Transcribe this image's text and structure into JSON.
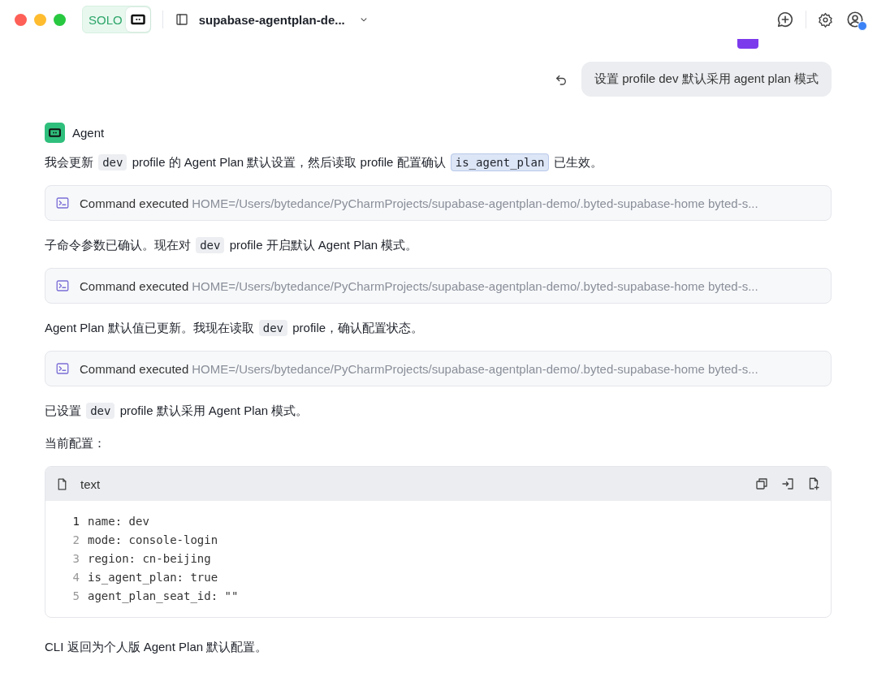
{
  "titlebar": {
    "mode_label": "SOLO",
    "mode_on": true,
    "project": "supabase-agentplan-de..."
  },
  "user_message": {
    "text": "设置 profile dev 默认采用 agent plan 模式"
  },
  "agent": {
    "name": "Agent"
  },
  "blocks": [
    {
      "kind": "para",
      "parts": [
        {
          "kind": "text",
          "text": "我会更新 "
        },
        {
          "kind": "code",
          "text": "dev",
          "highlighted": false
        },
        {
          "kind": "text",
          "text": " profile 的 Agent Plan 默认设置，然后读取 profile 配置确认 "
        },
        {
          "kind": "code",
          "text": "is_agent_plan",
          "highlighted": true
        },
        {
          "kind": "text",
          "text": " 已生效。"
        }
      ]
    },
    {
      "kind": "command",
      "label": "Command executed",
      "command": "HOME=/Users/bytedance/PyCharmProjects/supabase-agentplan-demo/.byted-supabase-home byted-s..."
    },
    {
      "kind": "para",
      "parts": [
        {
          "kind": "text",
          "text": "子命令参数已确认。现在对 "
        },
        {
          "kind": "code",
          "text": "dev",
          "highlighted": false
        },
        {
          "kind": "text",
          "text": " profile 开启默认 Agent Plan 模式。"
        }
      ]
    },
    {
      "kind": "command",
      "label": "Command executed",
      "command": "HOME=/Users/bytedance/PyCharmProjects/supabase-agentplan-demo/.byted-supabase-home byted-s..."
    },
    {
      "kind": "para",
      "parts": [
        {
          "kind": "text",
          "text": "Agent Plan 默认值已更新。我现在读取 "
        },
        {
          "kind": "code",
          "text": "dev",
          "highlighted": false
        },
        {
          "kind": "text",
          "text": " profile，确认配置状态。"
        }
      ]
    },
    {
      "kind": "command",
      "label": "Command executed",
      "command": "HOME=/Users/bytedance/PyCharmProjects/supabase-agentplan-demo/.byted-supabase-home byted-s..."
    },
    {
      "kind": "para",
      "parts": [
        {
          "kind": "text",
          "text": "已设置 "
        },
        {
          "kind": "code",
          "text": "dev",
          "highlighted": false
        },
        {
          "kind": "text",
          "text": " profile 默认采用 Agent Plan 模式。"
        }
      ]
    },
    {
      "kind": "para",
      "parts": [
        {
          "kind": "text",
          "text": "当前配置："
        }
      ]
    },
    {
      "kind": "codeblock",
      "language": "text",
      "lines": [
        {
          "number": "1",
          "text": "name: dev",
          "current": true
        },
        {
          "number": "2",
          "text": "mode: console-login",
          "current": false
        },
        {
          "number": "3",
          "text": "region: cn-beijing",
          "current": false
        },
        {
          "number": "4",
          "text": "is_agent_plan: true",
          "current": false
        },
        {
          "number": "5",
          "text": "agent_plan_seat_id: \"\"",
          "current": false
        }
      ]
    },
    {
      "kind": "para",
      "parts": [
        {
          "kind": "text",
          "text": "CLI 返回为个人版 Agent Plan 默认配置。"
        }
      ]
    }
  ]
}
